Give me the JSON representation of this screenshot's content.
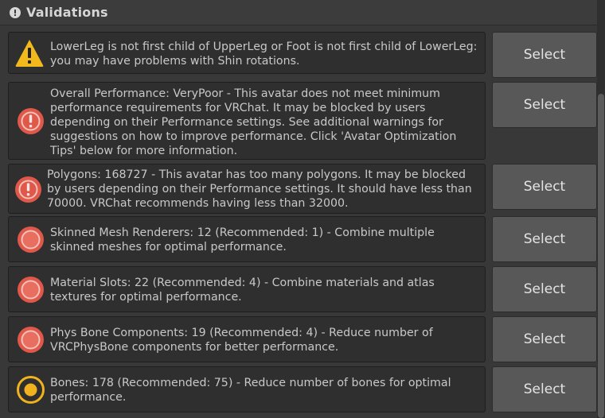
{
  "header": {
    "title": "Validations",
    "icon": "exclamation-circle-icon"
  },
  "items": [
    {
      "icon": "warning-triangle-icon",
      "severity": "warning",
      "text": "LowerLeg is not first child of UpperLeg or Foot is not first child of LowerLeg: you may have problems with Shin rotations.",
      "button": "Select"
    },
    {
      "icon": "error-exclamation-icon",
      "severity": "error",
      "text": "Overall Performance: VeryPoor - This avatar does not meet minimum performance requirements for VRChat. It may be blocked by users depending on their Performance settings. See additional warnings for suggestions on how to improve performance. Click 'Avatar Optimization Tips' below for more information.",
      "button": "Select"
    },
    {
      "icon": "error-exclamation-icon",
      "severity": "error",
      "text": "Polygons: 168727 - This avatar has too many polygons. It may be blocked by users depending on their Performance settings. It should have less than 70000. VRChat recommends having less than 32000.",
      "button": "Select"
    },
    {
      "icon": "red-dot-icon",
      "severity": "very-poor",
      "text": "Skinned Mesh Renderers: 12 (Recommended: 1) - Combine multiple skinned meshes for optimal performance.",
      "button": "Select"
    },
    {
      "icon": "red-dot-icon",
      "severity": "very-poor",
      "text": "Material Slots: 22 (Recommended: 4) - Combine materials and atlas textures for optimal performance.",
      "button": "Select"
    },
    {
      "icon": "red-dot-icon",
      "severity": "very-poor",
      "text": "Phys Bone Components: 19 (Recommended: 4) - Reduce number of VRCPhysBone components for better performance.",
      "button": "Select"
    },
    {
      "icon": "yellow-dot-icon",
      "severity": "poor",
      "text": "Bones: 178 (Recommended: 75) - Reduce number of bones for optimal performance.",
      "button": "Select"
    }
  ],
  "colors": {
    "warning": "#f2b91d",
    "error": "#e0584a",
    "poor": "#f0b21e"
  }
}
